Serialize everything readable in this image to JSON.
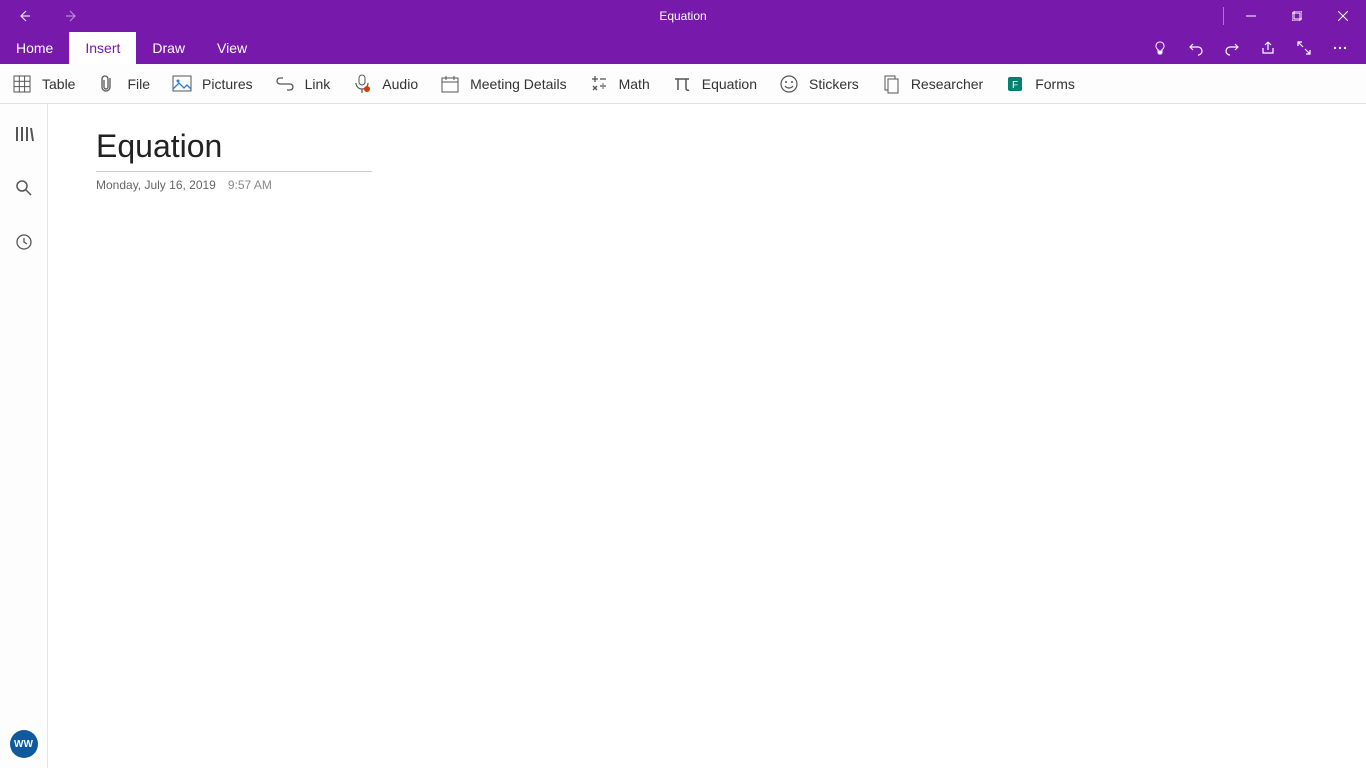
{
  "window": {
    "title": "Equation"
  },
  "tabs": {
    "home": "Home",
    "insert": "Insert",
    "draw": "Draw",
    "view": "View"
  },
  "ribbon": {
    "table": "Table",
    "file": "File",
    "pictures": "Pictures",
    "link": "Link",
    "audio": "Audio",
    "meeting": "Meeting Details",
    "math": "Math",
    "equation": "Equation",
    "stickers": "Stickers",
    "researcher": "Researcher",
    "forms": "Forms"
  },
  "page": {
    "title": "Equation",
    "date": "Monday, July 16, 2019",
    "time": "9:57 AM"
  },
  "avatar": {
    "initials": "WW"
  }
}
